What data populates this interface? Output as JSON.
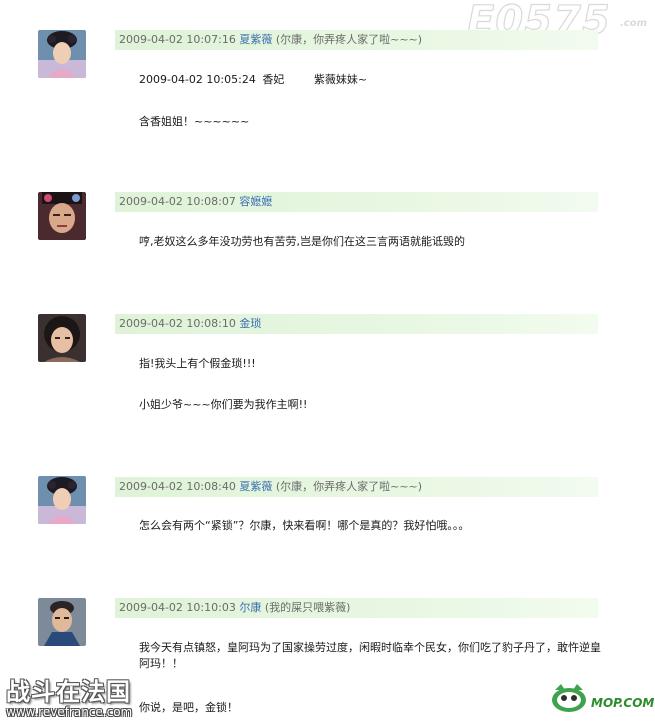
{
  "watermarks": {
    "top_right": "E0575",
    "top_right_sub": ".com",
    "bottom_left_title": "战斗在法国",
    "bottom_left_url": "www.revefrance.com",
    "bottom_right": "MOP.COM"
  },
  "messages": [
    {
      "timestamp": "2009-04-02 10:07:16",
      "name": "夏紫薇",
      "signature": "(尔康，你弄疼人家了啦~~~)",
      "avatar": "avatar-ziwei",
      "quote": {
        "timestamp": "2009-04-02 10:05:24",
        "name": "香妃",
        "text": "紫薇妹妹~"
      },
      "lines": [
        "含香姐姐！~~~~~~"
      ]
    },
    {
      "timestamp": "2009-04-02 10:08:07",
      "name": "容嬷嬷",
      "signature": "",
      "avatar": "avatar-rongmama",
      "lines": [
        "哼,老奴这么多年没功劳也有苦劳,岂是你们在这三言两语就能诋毁的"
      ]
    },
    {
      "timestamp": "2009-04-02 10:08:10",
      "name": "金琐",
      "signature": "",
      "avatar": "avatar-jinsuo",
      "lines": [
        "指!我头上有个假金琐!!!",
        "小姐少爷~~~你们要为我作主啊!!"
      ]
    },
    {
      "timestamp": "2009-04-02 10:08:40",
      "name": "夏紫薇",
      "signature": "(尔康，你弄疼人家了啦~~~)",
      "avatar": "avatar-ziwei",
      "lines": [
        "怎么会有两个“紧锁”？尔康，快来看啊！哪个是真的？我好怕哦。。。"
      ]
    },
    {
      "timestamp": "2009-04-02 10:10:03",
      "name": "尔康",
      "signature": "(我的屎只喂紫薇)",
      "avatar": "avatar-erkang",
      "lines": [
        "我今天有点镇怒，皇阿玛为了国家操劳过度，闲暇时临幸个民女，你们吃了豹子丹了，敢忤逆皇阿玛！！",
        "你说，是吧，金锁！"
      ]
    }
  ]
}
